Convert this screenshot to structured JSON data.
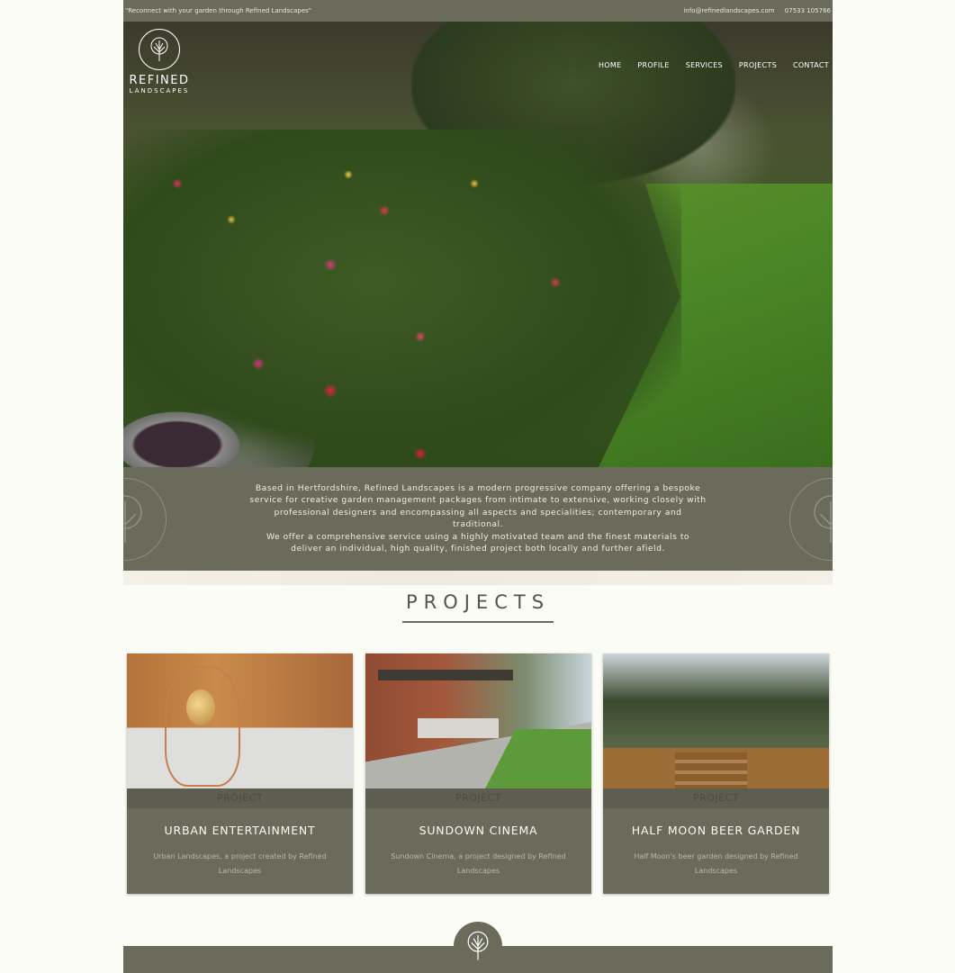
{
  "topbar": {
    "tagline": "\"Reconnect with your garden through Refined Landscapes\"",
    "email": "info@refinedlandscapes.com",
    "phone": "07533 105766"
  },
  "brand": {
    "line1": "REFINED",
    "line2": "LANDSCAPES",
    "logo_icon": "tree-icon"
  },
  "nav": {
    "items": [
      {
        "label": "HOME"
      },
      {
        "label": "PROFILE"
      },
      {
        "label": "SERVICES"
      },
      {
        "label": "PROJECTS"
      },
      {
        "label": "CONTACT"
      }
    ]
  },
  "intro": {
    "para1": "Based in Hertfordshire, Refined Landscapes is a modern progressive company offering a bespoke service for creative garden management packages from intimate to extensive, working closely with professional designers and encompassing all aspects and specialities; contemporary and traditional.",
    "para2": "We offer a comprehensive service using a highly motivated team and the finest materials to deliver an individual, high quality, finished project both locally and further afield."
  },
  "projects": {
    "heading": "PROJECTS",
    "cards": [
      {
        "tag": "PROJECT",
        "title": "URBAN ENTERTAINMENT",
        "desc": "Urban Landscapes, a project created by Refined Landscapes"
      },
      {
        "tag": "PROJECT",
        "title": "SUNDOWN CINEMA",
        "desc": "Sundown Cinema, a project designed by Refined Landscapes"
      },
      {
        "tag": "PROJECT",
        "title": "HALF MOON BEER GARDEN",
        "desc": "Half Moon's beer garden designed by Refined Landscapes"
      }
    ]
  },
  "colors": {
    "band": "#6b6b5c",
    "background": "#fbfcf6",
    "heading": "#55554a"
  }
}
